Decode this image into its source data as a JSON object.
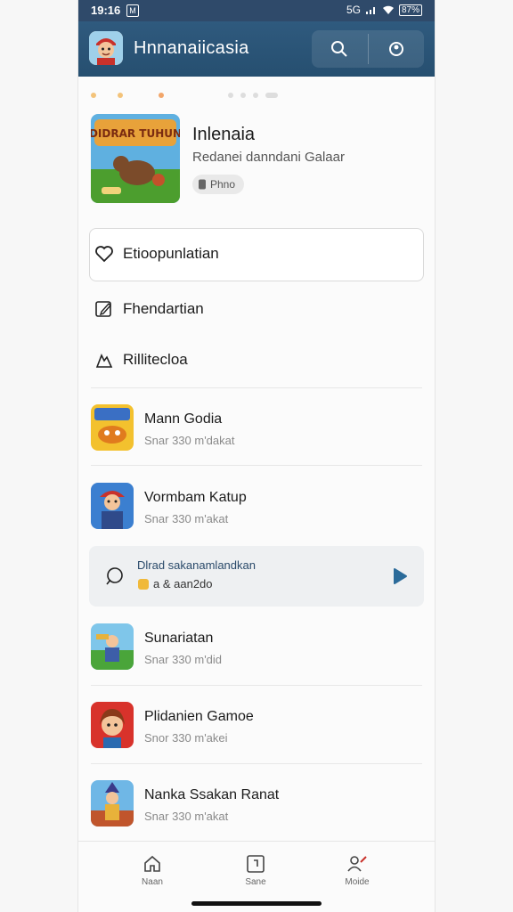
{
  "status": {
    "time": "19:16",
    "sim": "M",
    "signal_text": "5G",
    "battery": "87%"
  },
  "header": {
    "title": "Hnnanaiicasia"
  },
  "featured": {
    "thumb_text": "DIDRAR TUHUN",
    "title": "Inlenaia",
    "subtitle": "Redanei danndani Galaar",
    "badge": "Phno"
  },
  "menu": [
    {
      "label": "Etioopunlatian"
    },
    {
      "label": "Fhendartian"
    },
    {
      "label": "Rillitecloa"
    }
  ],
  "games": [
    {
      "name": "Mann Godia",
      "meta": "Snar 330 m'dakat"
    },
    {
      "name": "Vormbam Katup",
      "meta": "Snar 330 m'akat"
    },
    {
      "name": "Sunariatan",
      "meta": "Snar 330 m'did"
    },
    {
      "name": "Plidanien Gamoe",
      "meta": "Snor 330 m'akei"
    },
    {
      "name": "Nanka Ssakan Ranat",
      "meta": "Snar 330 m'akat"
    }
  ],
  "promo": {
    "title": "Dlrad sakanamlandkan",
    "sub": "a & aan2do"
  },
  "nav": [
    {
      "label": "Naan"
    },
    {
      "label": "Sane"
    },
    {
      "label": "Moide"
    }
  ],
  "colors": {
    "header": "#2f5a7e",
    "status": "#2f4a6a",
    "accent": "#2b6b9a"
  }
}
